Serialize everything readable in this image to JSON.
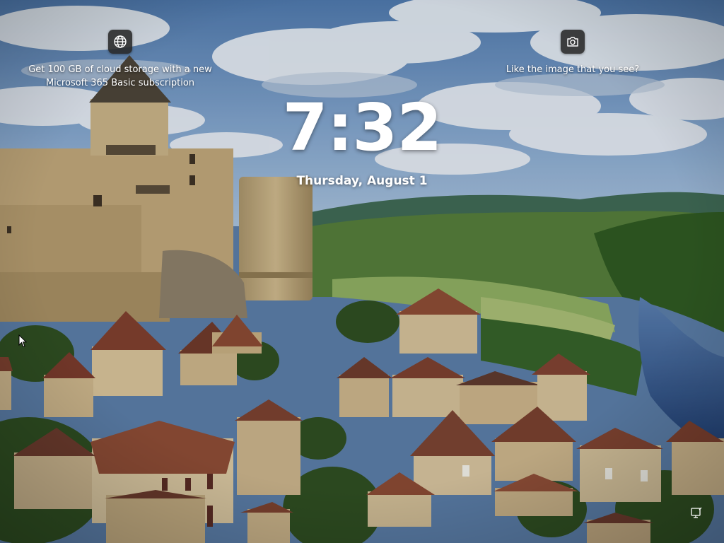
{
  "lockscreen": {
    "time": "7:32",
    "date": "Thursday, August 1"
  },
  "widgets": {
    "left": {
      "icon": "globe-icon",
      "text": "Get 100 GB of cloud storage with a new Microsoft 365 Basic subscription"
    },
    "right": {
      "icon": "camera-icon",
      "text": "Like the image that you see?"
    }
  },
  "status": {
    "icon": "network-icon"
  },
  "colors": {
    "text": "#ffffff",
    "icon_tile": "#282828",
    "sky": "#6d95c4",
    "river": "#2e4f86",
    "forest": "#3f6e2f",
    "stone": "#c7b184",
    "roof": "#8a4a34"
  }
}
